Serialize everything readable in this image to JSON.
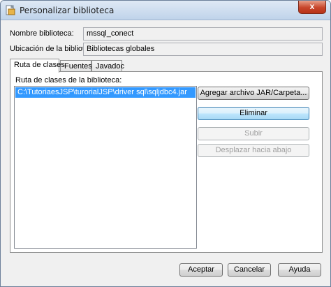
{
  "window": {
    "title": "Personalizar biblioteca",
    "close_symbol": "x"
  },
  "fields": {
    "name": {
      "label": "Nombre biblioteca:",
      "value": "mssql_conect"
    },
    "location": {
      "label": "Ubicación de la biblioteca",
      "value": "Bibliotecas globales"
    }
  },
  "tabs": [
    {
      "label": "Ruta de clases",
      "active": true
    },
    {
      "label": "Fuentes",
      "active": false
    },
    {
      "label": "Javadoc",
      "active": false
    }
  ],
  "classpath": {
    "label": "Ruta de clases de la biblioteca:",
    "items": [
      "C:\\TutoriaesJSP\\turorialJSP\\driver sql\\sqljdbc4.jar"
    ]
  },
  "actions": {
    "add": "Agregar archivo JAR/Carpeta...",
    "remove": "Eliminar",
    "up": "Subir",
    "down": "Desplazar hacia abajo"
  },
  "footer": {
    "ok": "Aceptar",
    "cancel": "Cancelar",
    "help": "Ayuda"
  },
  "colors": {
    "selection": "#3399ff",
    "focus_button": "#bee6fd",
    "close_button": "#c7452b"
  }
}
